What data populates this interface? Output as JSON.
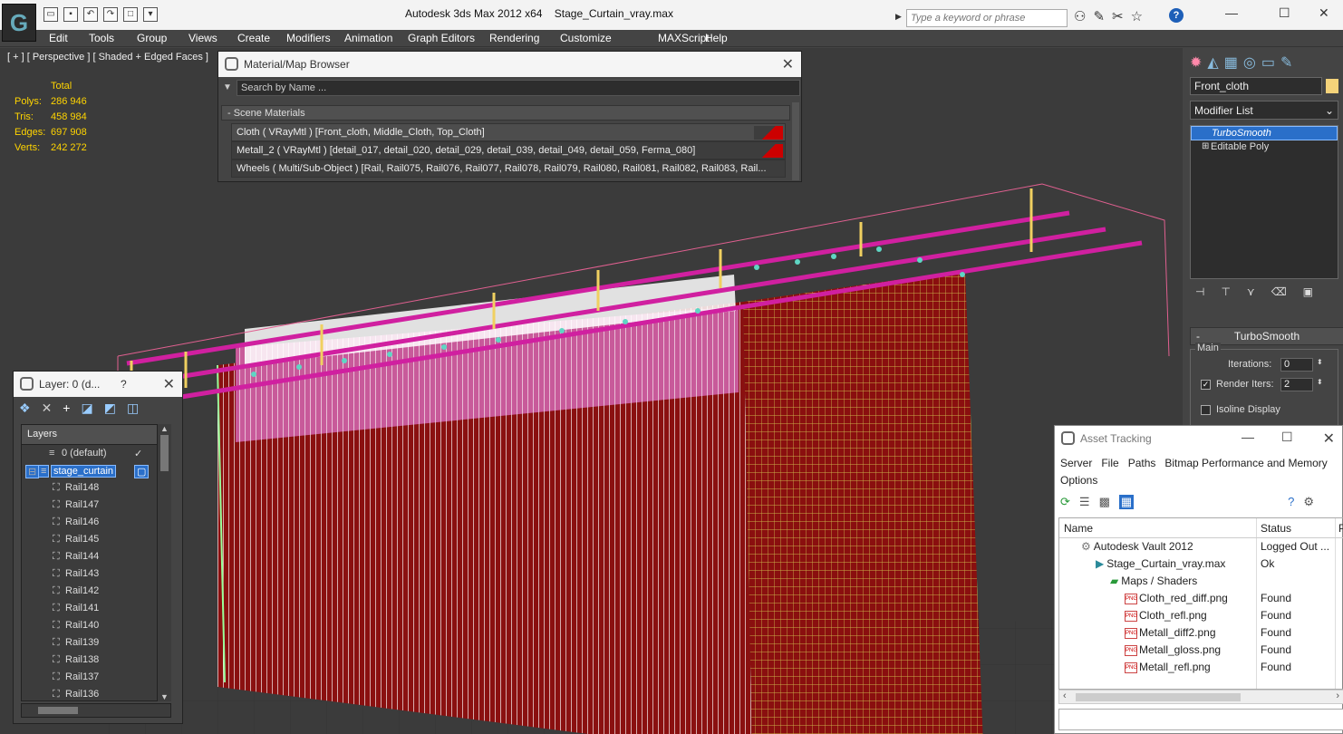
{
  "window": {
    "app_title": "Autodesk 3ds Max  2012 x64",
    "file_name": "Stage_Curtain_vray.max"
  },
  "search": {
    "placeholder": "Type a keyword or phrase"
  },
  "menu": [
    "Edit",
    "Tools",
    "Group",
    "Views",
    "Create",
    "Modifiers",
    "Animation",
    "Graph Editors",
    "Rendering",
    "Customize",
    "MAXScript",
    "Help"
  ],
  "viewport": {
    "label": "[ + ] [ Perspective ] [ Shaded + Edged Faces ]",
    "stats": {
      "header": "Total",
      "polys_label": "Polys:",
      "polys": "286 946",
      "tris_label": "Tris:",
      "tris": "458 984",
      "edges_label": "Edges:",
      "edges": "697 908",
      "verts_label": "Verts:",
      "verts": "242 272"
    }
  },
  "material_browser": {
    "title": "Material/Map Browser",
    "search_placeholder": "Search by Name ...",
    "section": "- Scene Materials",
    "rows": [
      "Cloth  ( VRayMtl )  [Front_cloth, Middle_Cloth, Top_Cloth]",
      "Metall_2  ( VRayMtl )  [detail_017, detail_020, detail_029, detail_039, detail_049, detail_059, Ferma_080]",
      "Wheels  ( Multi/Sub-Object )  [Rail, Rail075, Rail076, Rail077, Rail078, Rail079, Rail080, Rail081, Rail082, Rail083, Rail..."
    ],
    "swatch_color": "#cc0000"
  },
  "layer_dialog": {
    "title": "Layer: 0 (d...",
    "help": "?",
    "header": "Layers",
    "rows": [
      {
        "label": "0 (default)",
        "indent": 1
      },
      {
        "label": "stage_curtain",
        "indent": 0
      },
      {
        "label": "Rail148",
        "indent": 2
      },
      {
        "label": "Rail147",
        "indent": 2
      },
      {
        "label": "Rail146",
        "indent": 2
      },
      {
        "label": "Rail145",
        "indent": 2
      },
      {
        "label": "Rail144",
        "indent": 2
      },
      {
        "label": "Rail143",
        "indent": 2
      },
      {
        "label": "Rail142",
        "indent": 2
      },
      {
        "label": "Rail141",
        "indent": 2
      },
      {
        "label": "Rail140",
        "indent": 2
      },
      {
        "label": "Rail139",
        "indent": 2
      },
      {
        "label": "Rail138",
        "indent": 2
      },
      {
        "label": "Rail137",
        "indent": 2
      },
      {
        "label": "Rail136",
        "indent": 2
      }
    ]
  },
  "command_panel": {
    "object_name": "Front_cloth",
    "object_color": "#f5d37a",
    "modifier_list": "Modifier List",
    "stack": [
      "TurboSmooth",
      "Editable Poly"
    ],
    "rollout": "TurboSmooth",
    "group": "Main",
    "iterations_label": "Iterations:",
    "iterations": "0",
    "render_iters_label": "Render Iters:",
    "render_iters": "2",
    "isoline_label": "Isoline Display"
  },
  "asset_tracking": {
    "title": "Asset Tracking",
    "menu": [
      "Server",
      "File",
      "Paths",
      "Bitmap Performance and Memory"
    ],
    "menu2": "Options",
    "col_name": "Name",
    "col_status": "Status",
    "col_extra": "P",
    "rows": [
      {
        "name": "Autodesk Vault 2012",
        "status": "Logged Out ...",
        "indent": 1,
        "icon": "vault"
      },
      {
        "name": "Stage_Curtain_vray.max",
        "status": "Ok",
        "indent": 2,
        "icon": "max"
      },
      {
        "name": "Maps / Shaders",
        "status": "",
        "indent": 3,
        "icon": "maps"
      },
      {
        "name": "Cloth_red_diff.png",
        "status": "Found",
        "indent": 4,
        "icon": "png"
      },
      {
        "name": "Cloth_refl.png",
        "status": "Found",
        "indent": 4,
        "icon": "png"
      },
      {
        "name": "Metall_diff2.png",
        "status": "Found",
        "indent": 4,
        "icon": "png"
      },
      {
        "name": "Metall_gloss.png",
        "status": "Found",
        "indent": 4,
        "icon": "png"
      },
      {
        "name": "Metall_refl.png",
        "status": "Found",
        "indent": 4,
        "icon": "png"
      }
    ]
  }
}
